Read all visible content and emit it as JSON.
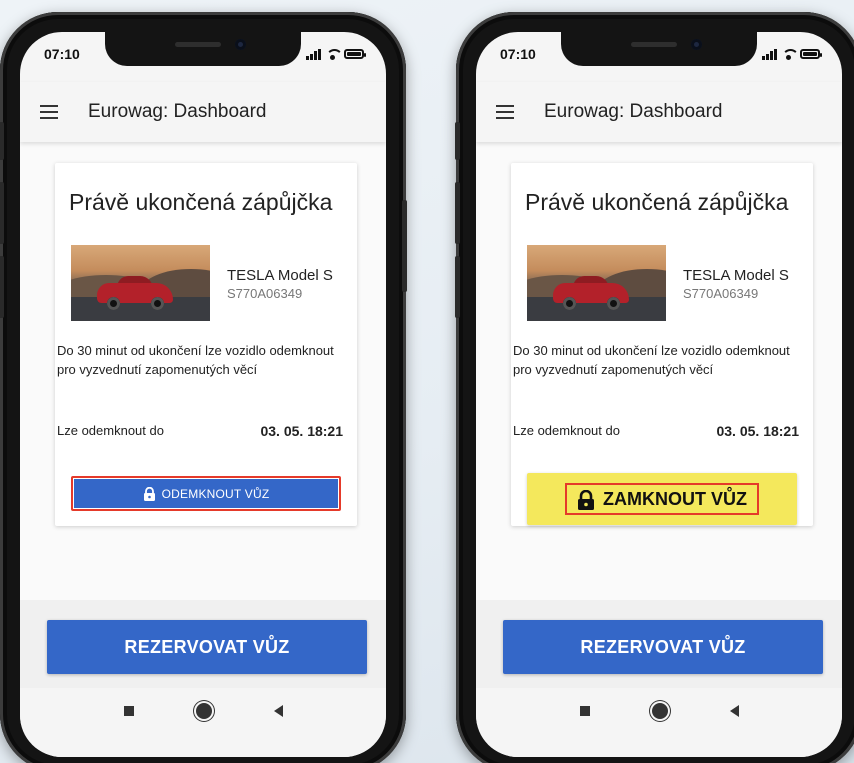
{
  "status_bar": {
    "time": "07:10"
  },
  "app_bar": {
    "title": "Eurowag: Dashboard",
    "menu_icon": "hamburger-menu-icon"
  },
  "card": {
    "title": "Právě ukončená zápůjčka",
    "car_name": "TESLA Model S",
    "car_plate": "S770A06349",
    "description": "Do 30 minut od ukončení lze vozidlo odemknout pro vyzvednutí zapomenutých věcí",
    "unlock_label": "Lze odemknout do",
    "unlock_until": "03. 05. 18:21"
  },
  "left_screen": {
    "action_button": "ODEMKNOUT VŮZ",
    "action_icon": "lock-icon",
    "action_color": "#3467c8"
  },
  "right_screen": {
    "action_button": "ZAMKNOUT VŮZ",
    "action_icon": "lock-icon",
    "action_color": "#f4e85c"
  },
  "reserve_button": "REZERVOVAT VŮZ",
  "nav": {
    "recent": "square-icon",
    "home": "circle-icon",
    "back": "back-triangle-icon"
  },
  "colors": {
    "primary": "#3467c8",
    "highlight": "#f4e85c",
    "annotation": "#e53a2a"
  }
}
